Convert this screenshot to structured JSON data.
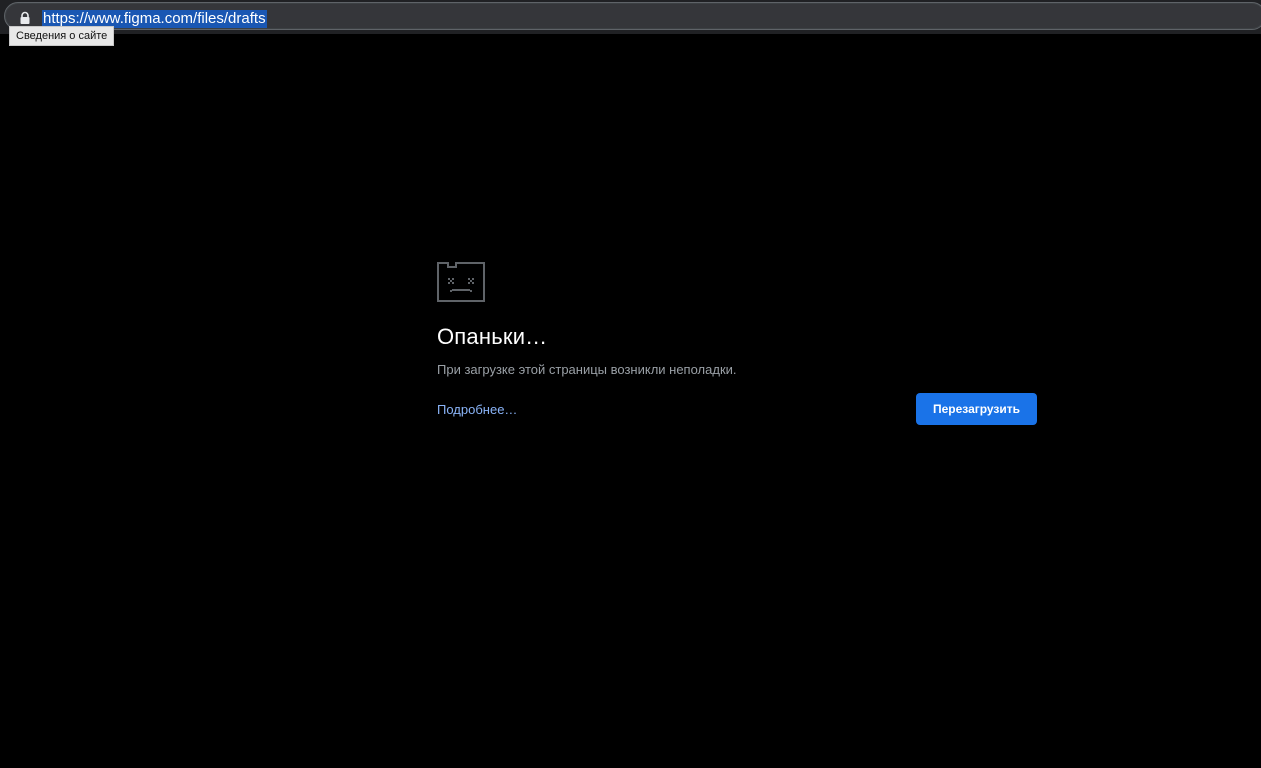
{
  "browser": {
    "url": "https://www.figma.com/files/drafts",
    "lock_icon": "lock-icon",
    "tooltip": "Сведения о сайте"
  },
  "error_page": {
    "icon": "sad-folder-icon",
    "title": "Опаньки…",
    "message": "При загрузке этой страницы возникли неполадки.",
    "details_link": "Подробнее…",
    "reload_button": "Перезагрузить"
  },
  "colors": {
    "background": "#000000",
    "toolbar": "#202124",
    "url_selection": "#1a57b3",
    "link": "#8ab4f8",
    "button": "#1a73e8",
    "message_text": "#9aa0a6"
  }
}
